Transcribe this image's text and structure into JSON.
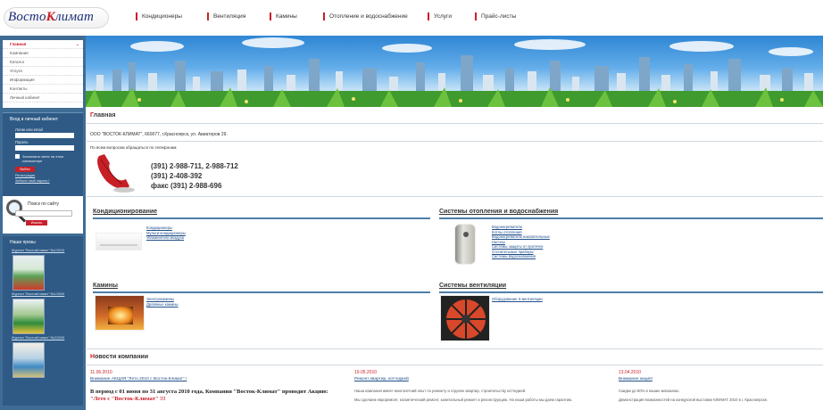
{
  "header": {
    "logo_main": "Восто",
    "logo_accent": "К",
    "logo_tail": "лимат",
    "nav": [
      "Кондиционеры",
      "Вентиляция",
      "Камины",
      "Отопление и водоснабжение",
      "Услуги",
      "Прайс-листы"
    ]
  },
  "sidebar": {
    "menu": [
      "Главная",
      "Компания",
      "Каталог",
      "Услуги",
      "Информация",
      "Контакты",
      "Личный кабинет"
    ],
    "login": {
      "title": "Вход в личный кабинет",
      "login_label": "Логин или email",
      "password_label": "Пароль",
      "remember_label": "Запомнить меня на этом компьютере",
      "submit": "Войти",
      "register": "Регистрация",
      "forgot": "Забыли свой пароль?"
    },
    "search": {
      "title": "Поиск по сайту",
      "button": "Искать"
    },
    "prizes": {
      "title": "Наши призы",
      "items": [
        "Журнал \"ВостокКлимат\" №1/2010",
        "Журнал \"ВостокКлимат\" №1/2009",
        "Журнал \"ВостокКлимат\" №2/2009"
      ]
    }
  },
  "main": {
    "title_first": "Г",
    "title_rest": "лавная",
    "address": "ООО \"ВОСТОК-КЛИМАТ\", 660077, г.Красноярск, ул. Авиаторов 29.",
    "contact_note": "По всем вопросам обращаться по телефонам:",
    "phones": [
      "(391) 2-988-711, 2-988-712",
      "(391) 2-408-392",
      "факс (391) 2-988-696"
    ],
    "sections": {
      "conditioning": {
        "title": "Кондиционирование",
        "links": [
          "Кондиционеры",
          "Мульти-кондиционеры",
          "Увлажнители воздуха"
        ]
      },
      "heating": {
        "title": "Системы отопления и водоснабжения",
        "links": [
          "Водонагреватели",
          "Котлы отопления",
          "Водонагреватели накопительные",
          "Насосы",
          "Системы защиты от протечек",
          "Отопительные приборы",
          "Системы водоснабжения"
        ]
      },
      "fireplaces": {
        "title": "Камины",
        "links": [
          "Электрокамины",
          "Дровяные камины"
        ]
      },
      "ventilation": {
        "title": "Системы вентиляции",
        "links": [
          "Оборудование S-вентиляции"
        ]
      }
    },
    "news": {
      "title_first": "Н",
      "title_rest": "овости компании",
      "items": [
        {
          "date": "11.06.2010",
          "title": "Внимание АКЦИЯ \"Лето 2010 с Восток-Климат\" !",
          "bold": "В период с 01 июня по 31 августа 2010 года, Компания \"Восток-Климат\" проводит Акцию:",
          "bold_red": "\"Лето с \"Восток-Климат\" !!!"
        },
        {
          "date": "19.05.2010",
          "title": "Ремонт квартир, коттеджей",
          "body1": "Наша компания имеет многолетний опыт по ремонту и отделке квартир, строительству коттеджей.",
          "body2": "Мы сделаем евроремонт, косметический ремонт, капитальный ремонт и реконструкцию. На наши работы мы даем гарантию."
        },
        {
          "date": "13.04.2010",
          "title": "Внимание акция!",
          "body1": "Скидки до 50% в наших магазинах.",
          "body2": "Демонстрация возможностей на конкурсной выставке КЛИМАТ 2010 в г. Красноярске."
        }
      ]
    }
  }
}
